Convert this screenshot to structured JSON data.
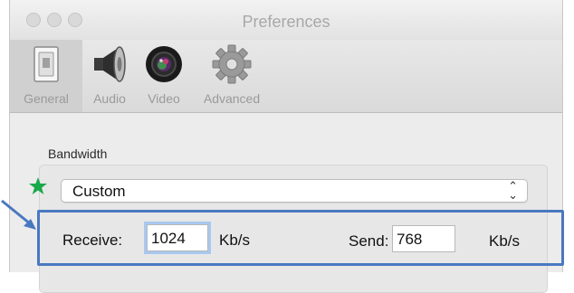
{
  "window": {
    "title": "Preferences"
  },
  "toolbar": {
    "items": [
      {
        "label": "General",
        "icon": "general-switch-icon",
        "selected": true
      },
      {
        "label": "Audio",
        "icon": "speaker-icon",
        "selected": false
      },
      {
        "label": "Video",
        "icon": "camera-lens-icon",
        "selected": false
      },
      {
        "label": "Advanced",
        "icon": "gear-icon",
        "selected": false
      }
    ]
  },
  "bandwidth": {
    "section_label": "Bandwidth",
    "preset": "Custom",
    "receive_label": "Receive:",
    "receive_value": "1024",
    "receive_unit": "Kb/s",
    "send_label": "Send:",
    "send_value": "768",
    "send_unit": "Kb/s"
  },
  "annotations": {
    "star_color": "#19a84b",
    "highlight_color": "#4a78c0"
  }
}
